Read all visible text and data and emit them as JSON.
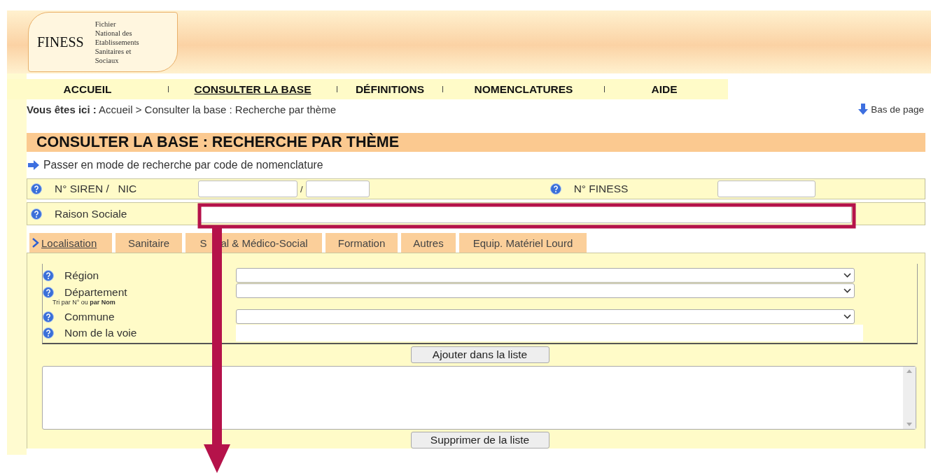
{
  "header": {
    "logo": {
      "name": "FINESS",
      "subtitle_lines": [
        "Fichier",
        "National des",
        "Etablissements",
        "Sanitaires et",
        "Sociaux"
      ]
    }
  },
  "nav": [
    {
      "label": "ACCUEIL",
      "selected": false
    },
    {
      "label": "CONSULTER LA BASE",
      "selected": true
    },
    {
      "label": "DÉFINITIONS",
      "selected": false
    },
    {
      "label": "NOMENCLATURES",
      "selected": false
    },
    {
      "label": "AIDE",
      "selected": false
    }
  ],
  "breadcrumb": {
    "label": "Vous êtes ici :",
    "path": "Accueil > Consulter la base : Recherche par thème"
  },
  "page_bottom_link": "Bas de page",
  "title": "CONSULTER LA BASE : RECHERCHE PAR THÈME",
  "mode_link": "Passer en mode de recherche par code de nomenclature",
  "identifiers": {
    "siren_label": "N° SIREN /   NIC",
    "separator": "/",
    "finess_label": "N° FINESS",
    "raison_sociale_label": "Raison Sociale"
  },
  "tabs": [
    {
      "label": "Localisation",
      "selected": true
    },
    {
      "label": "Sanitaire",
      "selected": false
    },
    {
      "label": "S",
      "label_rest": "al & Médico-Social",
      "selected": false
    },
    {
      "label": "Formation",
      "selected": false
    },
    {
      "label": "Autres",
      "selected": false
    },
    {
      "label": "Equip. Matériel Lourd",
      "selected": false
    }
  ],
  "localisation": {
    "rows": [
      {
        "label": "Région",
        "kind": "select"
      },
      {
        "label": "Département",
        "kind": "select",
        "hint": "Tri par N° ou **par Nom**"
      },
      {
        "label": "Commune",
        "kind": "select"
      },
      {
        "label": "Nom de la voie",
        "kind": "input"
      }
    ],
    "add_button": "Ajouter dans la liste",
    "remove_button": "Supprimer de la liste"
  },
  "annotation": {
    "kind": "arrow"
  }
}
